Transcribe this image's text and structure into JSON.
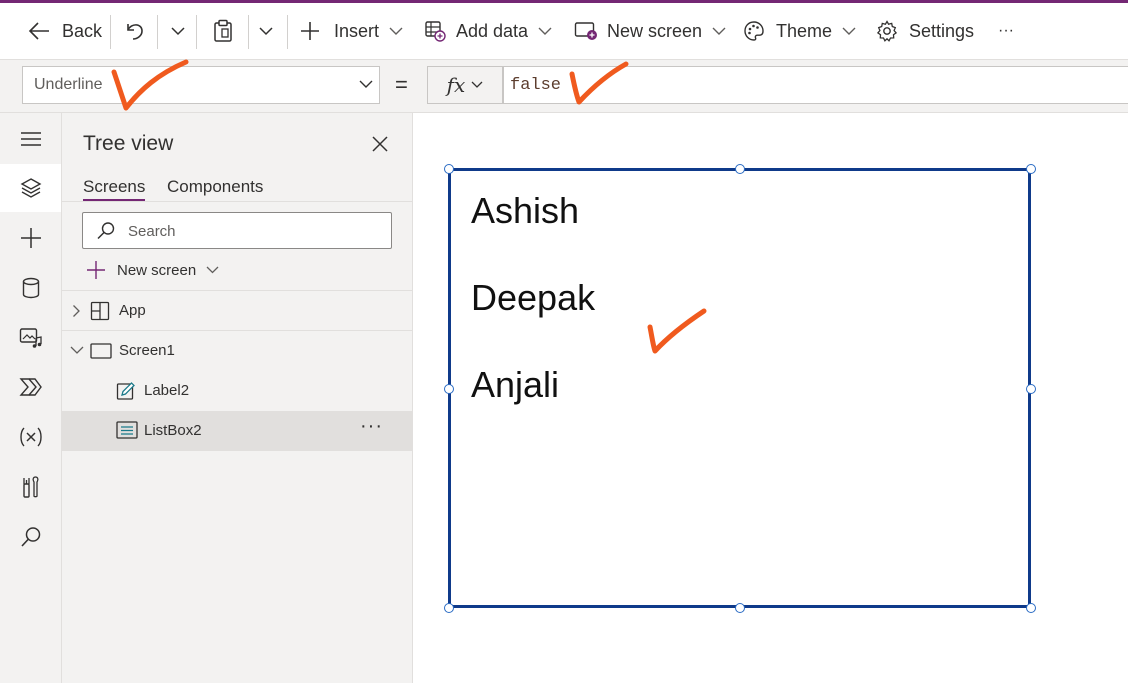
{
  "toolbar": {
    "back_label": "Back",
    "insert_label": "Insert",
    "add_data_label": "Add data",
    "new_screen_label": "New screen",
    "theme_label": "Theme",
    "settings_label": "Settings",
    "more_label": "···"
  },
  "formula_bar": {
    "property_value": "Underline",
    "equals": "=",
    "fx_label": "fx",
    "formula_value": "false"
  },
  "rail": {
    "icons": [
      "hamburger-icon",
      "layers-icon",
      "plus-icon",
      "database-icon",
      "media-icon",
      "power-automate-icon",
      "variables-icon",
      "tools-icon",
      "search-icon"
    ]
  },
  "tree_view": {
    "title": "Tree view",
    "tabs": [
      "Screens",
      "Components"
    ],
    "active_tab": "Screens",
    "search_placeholder": "Search",
    "new_screen_label": "New screen",
    "nodes": [
      {
        "label": "App",
        "icon": "app-grid-icon"
      },
      {
        "label": "Screen1",
        "icon": "screen-icon"
      },
      {
        "label": "Label2",
        "icon": "label-edit-icon"
      },
      {
        "label": "ListBox2",
        "icon": "listbox-icon",
        "selected": true
      }
    ],
    "more_label": "···"
  },
  "canvas": {
    "listbox_items": [
      "Ashish",
      "Deepak",
      "Anjali"
    ]
  },
  "colors": {
    "accent": "#742774",
    "selection_border": "#0f3a8a",
    "annotation": "#f05a1e"
  }
}
